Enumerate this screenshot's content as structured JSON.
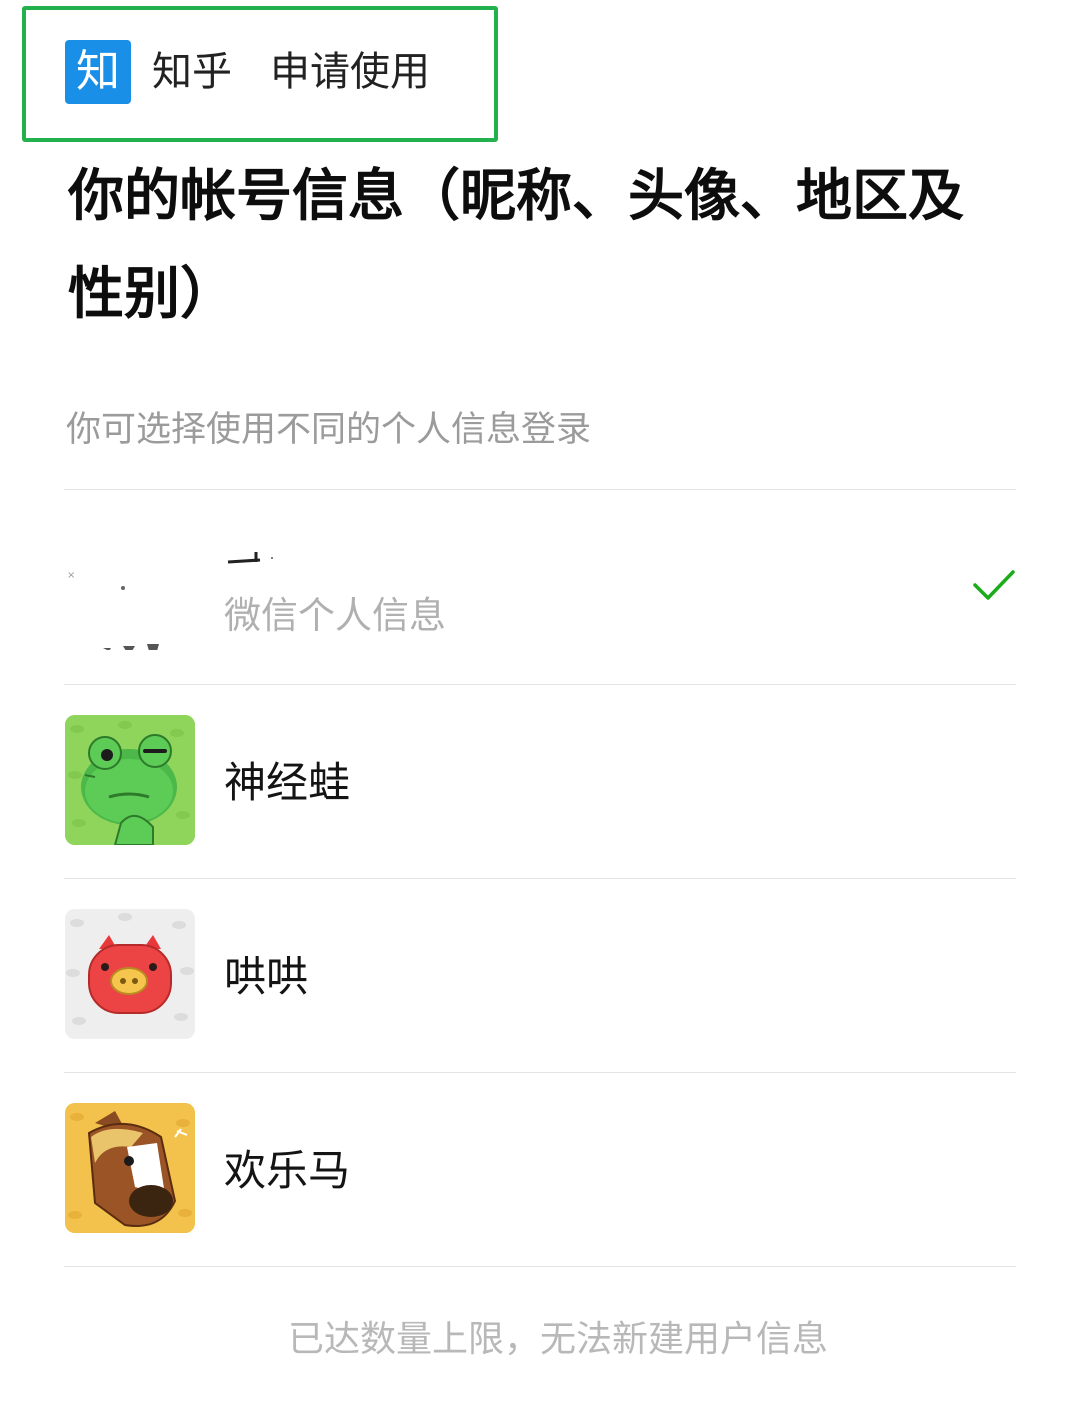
{
  "app": {
    "logo_char": "知",
    "name": "知乎",
    "request": "申请使用"
  },
  "title": "你的帐号信息（昵称、头像、地区及性别）",
  "subtitle": "你可选择使用不同的个人信息登录",
  "profiles": [
    {
      "name": "",
      "sublabel": "微信个人信息",
      "selected": true,
      "avatar_icon": "wechat-avatar-icon"
    },
    {
      "name": "神经蛙",
      "selected": false,
      "avatar_icon": "frog-avatar-icon"
    },
    {
      "name": "哄哄",
      "selected": false,
      "avatar_icon": "pig-avatar-icon"
    },
    {
      "name": "欢乐马",
      "selected": false,
      "avatar_icon": "horse-avatar-icon"
    }
  ],
  "footer": "已达数量上限，无法新建用户信息",
  "colors": {
    "accent": "#22b14c",
    "logo": "#1a8fe8",
    "check": "#1aad19"
  }
}
